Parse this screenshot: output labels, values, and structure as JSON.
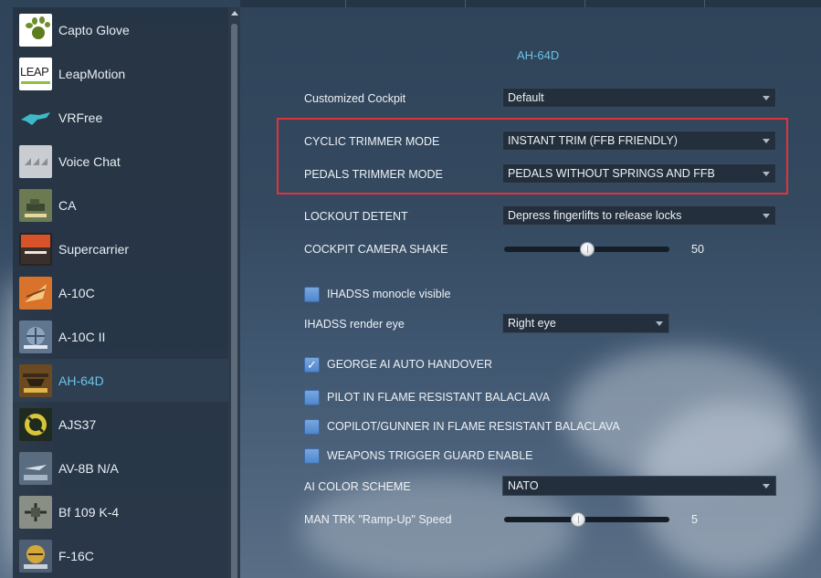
{
  "sidebar": {
    "items": [
      {
        "label": "Capto Glove",
        "icon": "capto-glove-icon"
      },
      {
        "label": "LeapMotion",
        "icon": "leapmotion-icon"
      },
      {
        "label": "VRFree",
        "icon": "vrfree-icon"
      },
      {
        "label": "Voice Chat",
        "icon": "voice-chat-icon"
      },
      {
        "label": "CA",
        "icon": "combined-arms-icon"
      },
      {
        "label": "Supercarrier",
        "icon": "supercarrier-icon"
      },
      {
        "label": "A-10C",
        "icon": "a10c-icon"
      },
      {
        "label": "A-10C II",
        "icon": "a10c-ii-icon"
      },
      {
        "label": "AH-64D",
        "icon": "ah64d-icon",
        "active": true
      },
      {
        "label": "AJS37",
        "icon": "ajs37-icon"
      },
      {
        "label": "AV-8B N/A",
        "icon": "av8b-icon"
      },
      {
        "label": "Bf 109 K-4",
        "icon": "bf109-icon"
      },
      {
        "label": "F-16C",
        "icon": "f16c-icon"
      }
    ]
  },
  "main": {
    "title": "AH-64D",
    "options": {
      "customized_cockpit": {
        "label": "Customized Cockpit",
        "value": "Default"
      },
      "cyclic_trimmer_mode": {
        "label": "CYCLIC TRIMMER MODE",
        "value": "INSTANT TRIM (FFB FRIENDLY)"
      },
      "pedals_trimmer_mode": {
        "label": "PEDALS TRIMMER MODE",
        "value": "PEDALS WITHOUT SPRINGS AND FFB"
      },
      "lockout_detent": {
        "label": "LOCKOUT DETENT",
        "value": "Depress fingerlifts to release locks"
      },
      "cockpit_camera_shake": {
        "label": "COCKPIT CAMERA SHAKE",
        "value": "50",
        "fraction": 0.5
      },
      "ihadss_monocle_visible": {
        "label": "IHADSS monocle visible",
        "checked": false
      },
      "ihadss_render_eye": {
        "label": "IHADSS render eye",
        "value": "Right eye"
      },
      "george_ai_auto_handover": {
        "label": "GEORGE AI AUTO HANDOVER",
        "checked": true
      },
      "pilot_balaclava": {
        "label": "PILOT IN FLAME RESISTANT BALACLAVA",
        "checked": false
      },
      "copilot_balaclava": {
        "label": "COPILOT/GUNNER IN FLAME RESISTANT BALACLAVA",
        "checked": false
      },
      "weapons_trigger_guard": {
        "label": "WEAPONS TRIGGER GUARD ENABLE",
        "checked": false
      },
      "ai_color_scheme": {
        "label": "AI COLOR SCHEME",
        "value": "NATO"
      },
      "man_trk_ramp_up_speed": {
        "label": "MAN TRK \"Ramp-Up\" Speed",
        "value": "5",
        "fraction": 0.44
      }
    }
  },
  "colors": {
    "accent_text": "#6cc3e6",
    "checkbox": "#5a8fd3",
    "highlight": "#e0343b"
  }
}
